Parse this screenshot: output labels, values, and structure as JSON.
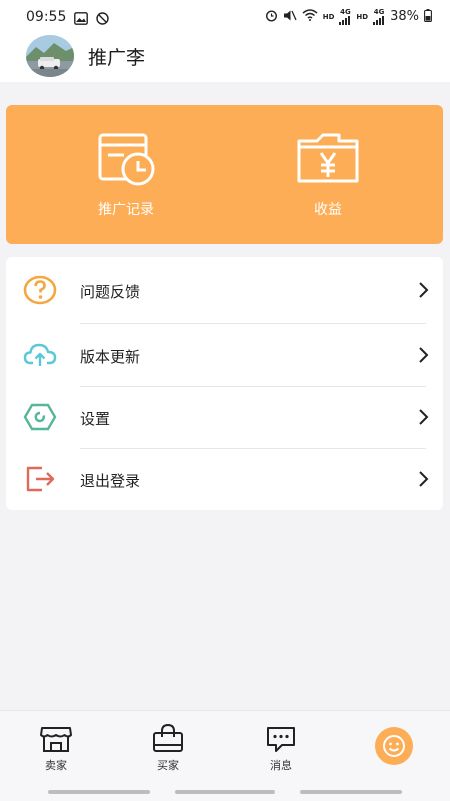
{
  "status_bar": {
    "time": "09:55",
    "network_1": "4G",
    "hd_1": "HD",
    "network_2": "4G",
    "hd_2": "HD",
    "battery": "38%"
  },
  "header": {
    "username": "推广李"
  },
  "promo_card": {
    "background": "#fcad55",
    "items": [
      {
        "label": "推广记录",
        "icon": "record-clock-icon"
      },
      {
        "label": "收益",
        "icon": "yen-folder-icon"
      }
    ]
  },
  "menu": {
    "items": [
      {
        "label": "问题反馈",
        "icon": "question-icon",
        "color": "#f4a640"
      },
      {
        "label": "版本更新",
        "icon": "cloud-upload-icon",
        "color": "#5bc8d8"
      },
      {
        "label": "设置",
        "icon": "settings-hexagon-icon",
        "color": "#56b69a"
      },
      {
        "label": "退出登录",
        "icon": "logout-icon",
        "color": "#e06a5a"
      }
    ]
  },
  "tabbar": {
    "tabs": [
      {
        "label": "卖家",
        "icon": "store-icon"
      },
      {
        "label": "买家",
        "icon": "shopping-bag-icon"
      },
      {
        "label": "消息",
        "icon": "message-icon"
      },
      {
        "label": "",
        "icon": "smiley-icon"
      }
    ],
    "active_color": "#fcad55"
  }
}
